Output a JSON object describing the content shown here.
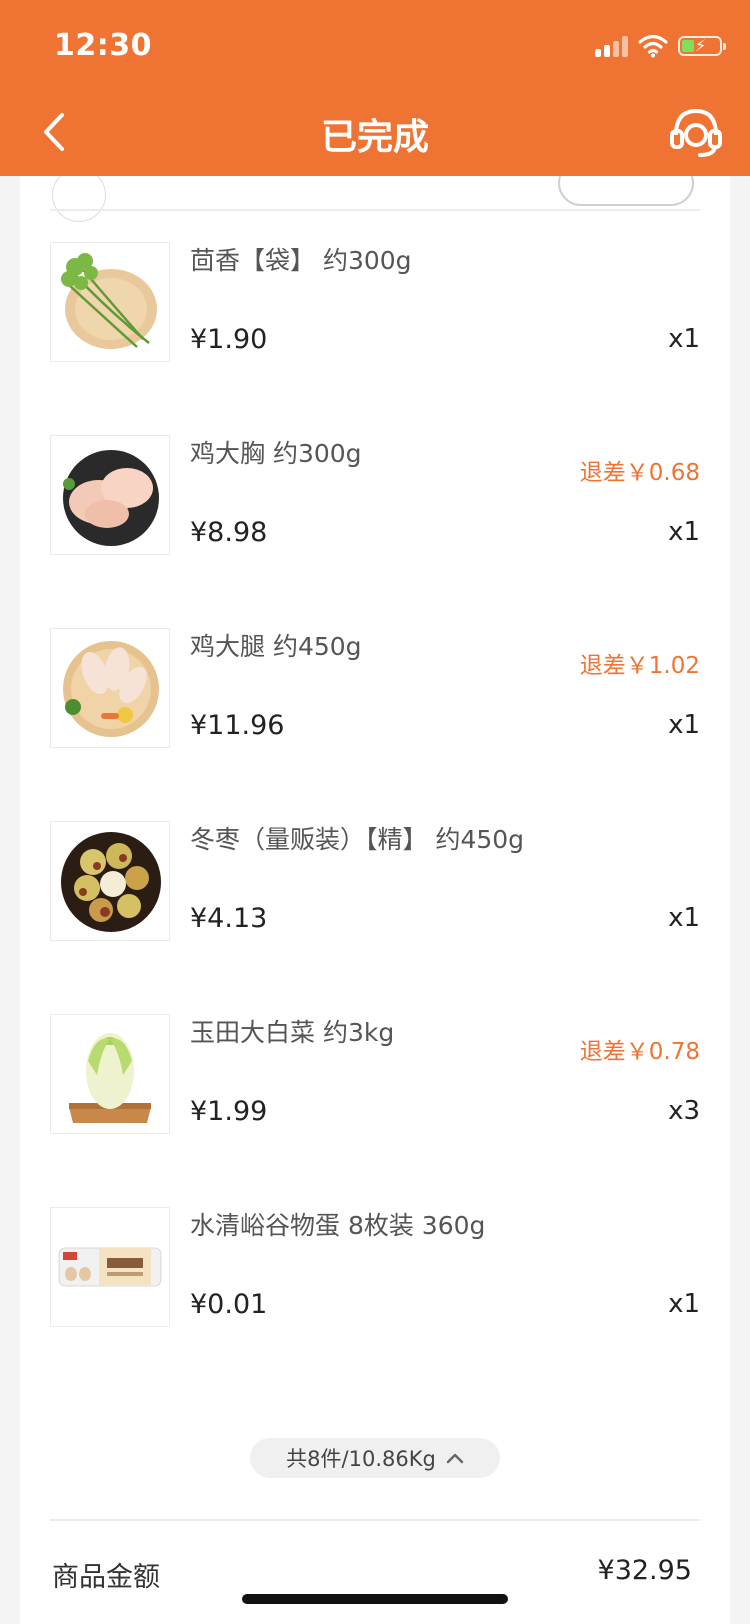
{
  "status_bar": {
    "time": "12:30"
  },
  "header": {
    "title": "已完成"
  },
  "items": [
    {
      "name": "茴香【袋】 约300g",
      "price": "¥1.90",
      "qty": "x1",
      "refund": "",
      "icon": "fennel-image"
    },
    {
      "name": "鸡大胸 约300g",
      "price": "¥8.98",
      "qty": "x1",
      "refund": "退差￥0.68",
      "icon": "chicken-breast-image"
    },
    {
      "name": "鸡大腿 约450g",
      "price": "¥11.96",
      "qty": "x1",
      "refund": "退差￥1.02",
      "icon": "chicken-leg-image"
    },
    {
      "name": "冬枣（量贩装）【精】 约450g",
      "price": "¥4.13",
      "qty": "x1",
      "refund": "",
      "icon": "winter-jujube-image"
    },
    {
      "name": "玉田大白菜 约3kg",
      "price": "¥1.99",
      "qty": "x3",
      "refund": "退差￥0.78",
      "icon": "napa-cabbage-image"
    },
    {
      "name": "水清峪谷物蛋 8枚装 360g",
      "price": "¥0.01",
      "qty": "x1",
      "refund": "",
      "icon": "egg-box-image"
    }
  ],
  "summary": {
    "label": "共8件/10.86Kg"
  },
  "totals": {
    "goods_amount_label": "商品金额",
    "goods_amount_value": "¥32.95"
  },
  "colors": {
    "brand": "#ef7434",
    "refund": "#ef7434"
  }
}
